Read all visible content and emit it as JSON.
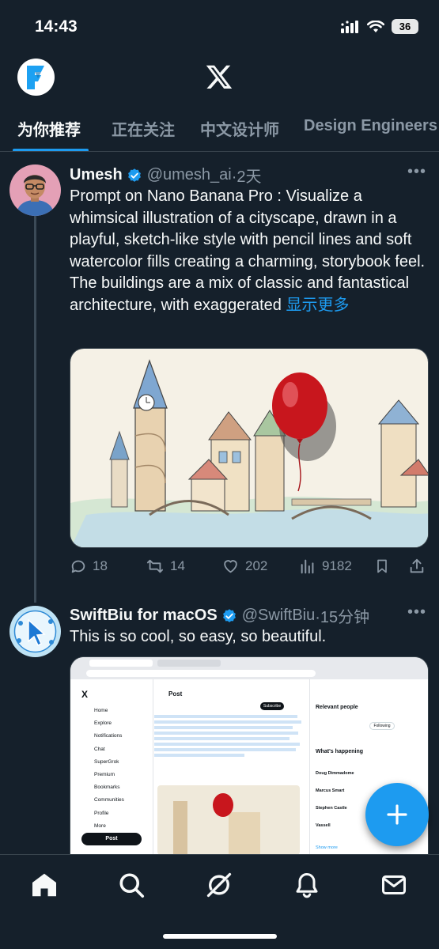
{
  "status_bar": {
    "time": "14:43",
    "battery": "36"
  },
  "tabs": [
    {
      "label": "为你推荐",
      "active": true
    },
    {
      "label": "正在关注",
      "active": false
    },
    {
      "label": "中文设计师",
      "active": false
    },
    {
      "label": "Design Engineers",
      "active": false
    }
  ],
  "tweets": [
    {
      "name": "Umesh",
      "handle": "@umesh_ai",
      "time": "·2天",
      "text": "Prompt on Nano Banana Pro : Visualize a whimsical illustration of a cityscape, drawn in a playful, sketch-like style with pencil lines and soft watercolor fills creating a charming, storybook feel. The buildings are a mix of classic and fantastical architecture, with exaggerated",
      "show_more": "显示更多",
      "stats": {
        "replies": "18",
        "retweets": "14",
        "likes": "202",
        "views": "9182"
      }
    },
    {
      "name": "SwiftBiu for macOS",
      "handle": "@SwiftBiu",
      "time": "·15分钟",
      "text": "This is so cool, so easy, so beautiful."
    }
  ],
  "embedded_screenshot": {
    "sidebar": [
      "Home",
      "Explore",
      "Notifications",
      "Chat",
      "SuperGrok",
      "Premium",
      "Bookmarks",
      "Communities",
      "Profile",
      "More"
    ],
    "post_button": "Post",
    "header": "Post",
    "subscribe": "Subscribe",
    "relevant_people": "Relevant people",
    "whats_happening": "What's happening",
    "following": "Following",
    "trends": [
      "Doug Dimmadome",
      "Marcus Smart",
      "Stephen Castle",
      "Vassell"
    ],
    "show_more": "Show more"
  },
  "colors": {
    "background": "#15202b",
    "accent": "#1d9bf0",
    "muted": "#8b98a5",
    "divider": "#38444d"
  }
}
